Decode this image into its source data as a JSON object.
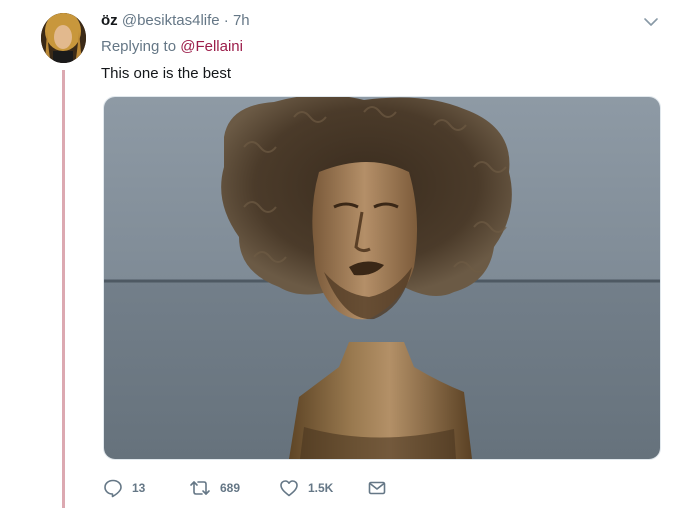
{
  "tweet": {
    "display_name": "öz",
    "handle": "@besiktas4life",
    "separator": "·",
    "time": "7h",
    "replying_prefix": "Replying to",
    "replying_to": "@Fellaini",
    "text": "This one is the best",
    "media_alt": "Bronze bust sculpture with large curly hair"
  },
  "actions": {
    "reply_count": "13",
    "retweet_count": "689",
    "like_count": "1.5K"
  },
  "icons": {
    "menu": "chevron-down-icon",
    "reply": "reply-icon",
    "retweet": "retweet-icon",
    "like": "heart-icon",
    "dm": "envelope-icon"
  },
  "colors": {
    "mention": "#9c1d4a",
    "thread_line": "#dca9b1",
    "secondary_text": "#657786",
    "primary_text": "#14171a"
  }
}
